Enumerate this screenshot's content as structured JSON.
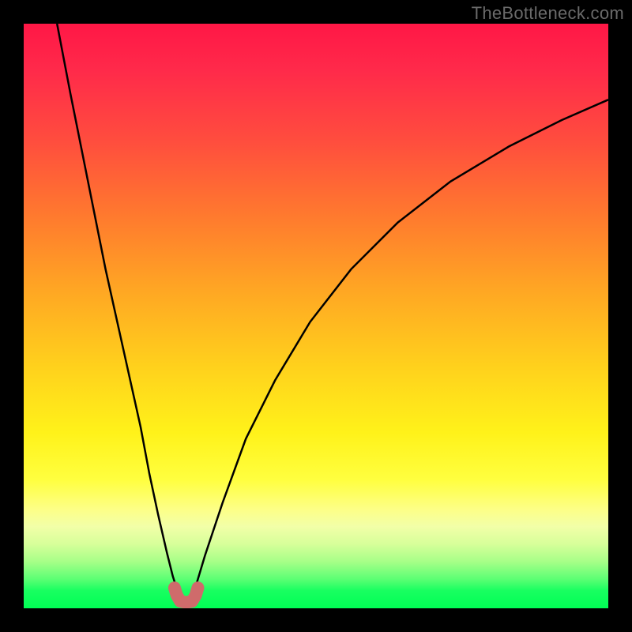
{
  "watermark": "TheBottleneck.com",
  "chart_data": {
    "type": "line",
    "title": "",
    "xlabel": "",
    "ylabel": "",
    "xlim": [
      0,
      1
    ],
    "ylim": [
      0,
      1
    ],
    "axes_visible": false,
    "grid": false,
    "background_gradient": {
      "orientation": "vertical",
      "stops": [
        {
          "pos": 0.0,
          "color": "#ff1746"
        },
        {
          "pos": 0.5,
          "color": "#ffd21c"
        },
        {
          "pos": 0.8,
          "color": "#ffff3f"
        },
        {
          "pos": 1.0,
          "color": "#00ff55"
        }
      ]
    },
    "series": [
      {
        "name": "left-branch",
        "stroke": "#000000",
        "stroke_width": 2.5,
        "x": [
          0.057,
          0.08,
          0.1,
          0.12,
          0.14,
          0.16,
          0.18,
          0.2,
          0.215,
          0.23,
          0.245,
          0.255,
          0.263,
          0.268
        ],
        "y": [
          1.0,
          0.88,
          0.78,
          0.68,
          0.58,
          0.49,
          0.4,
          0.31,
          0.23,
          0.16,
          0.095,
          0.055,
          0.03,
          0.018
        ]
      },
      {
        "name": "right-branch",
        "stroke": "#000000",
        "stroke_width": 2.5,
        "x": [
          0.288,
          0.295,
          0.31,
          0.34,
          0.38,
          0.43,
          0.49,
          0.56,
          0.64,
          0.73,
          0.83,
          0.92,
          1.0
        ],
        "y": [
          0.018,
          0.04,
          0.09,
          0.18,
          0.29,
          0.39,
          0.49,
          0.58,
          0.66,
          0.73,
          0.79,
          0.835,
          0.87
        ]
      },
      {
        "name": "valley-bump",
        "stroke": "#cf6b6b",
        "stroke_width": 16,
        "linecap": "round",
        "x": [
          0.258,
          0.262,
          0.268,
          0.278,
          0.288,
          0.294,
          0.298
        ],
        "y": [
          0.035,
          0.022,
          0.012,
          0.01,
          0.012,
          0.022,
          0.035
        ]
      }
    ]
  }
}
